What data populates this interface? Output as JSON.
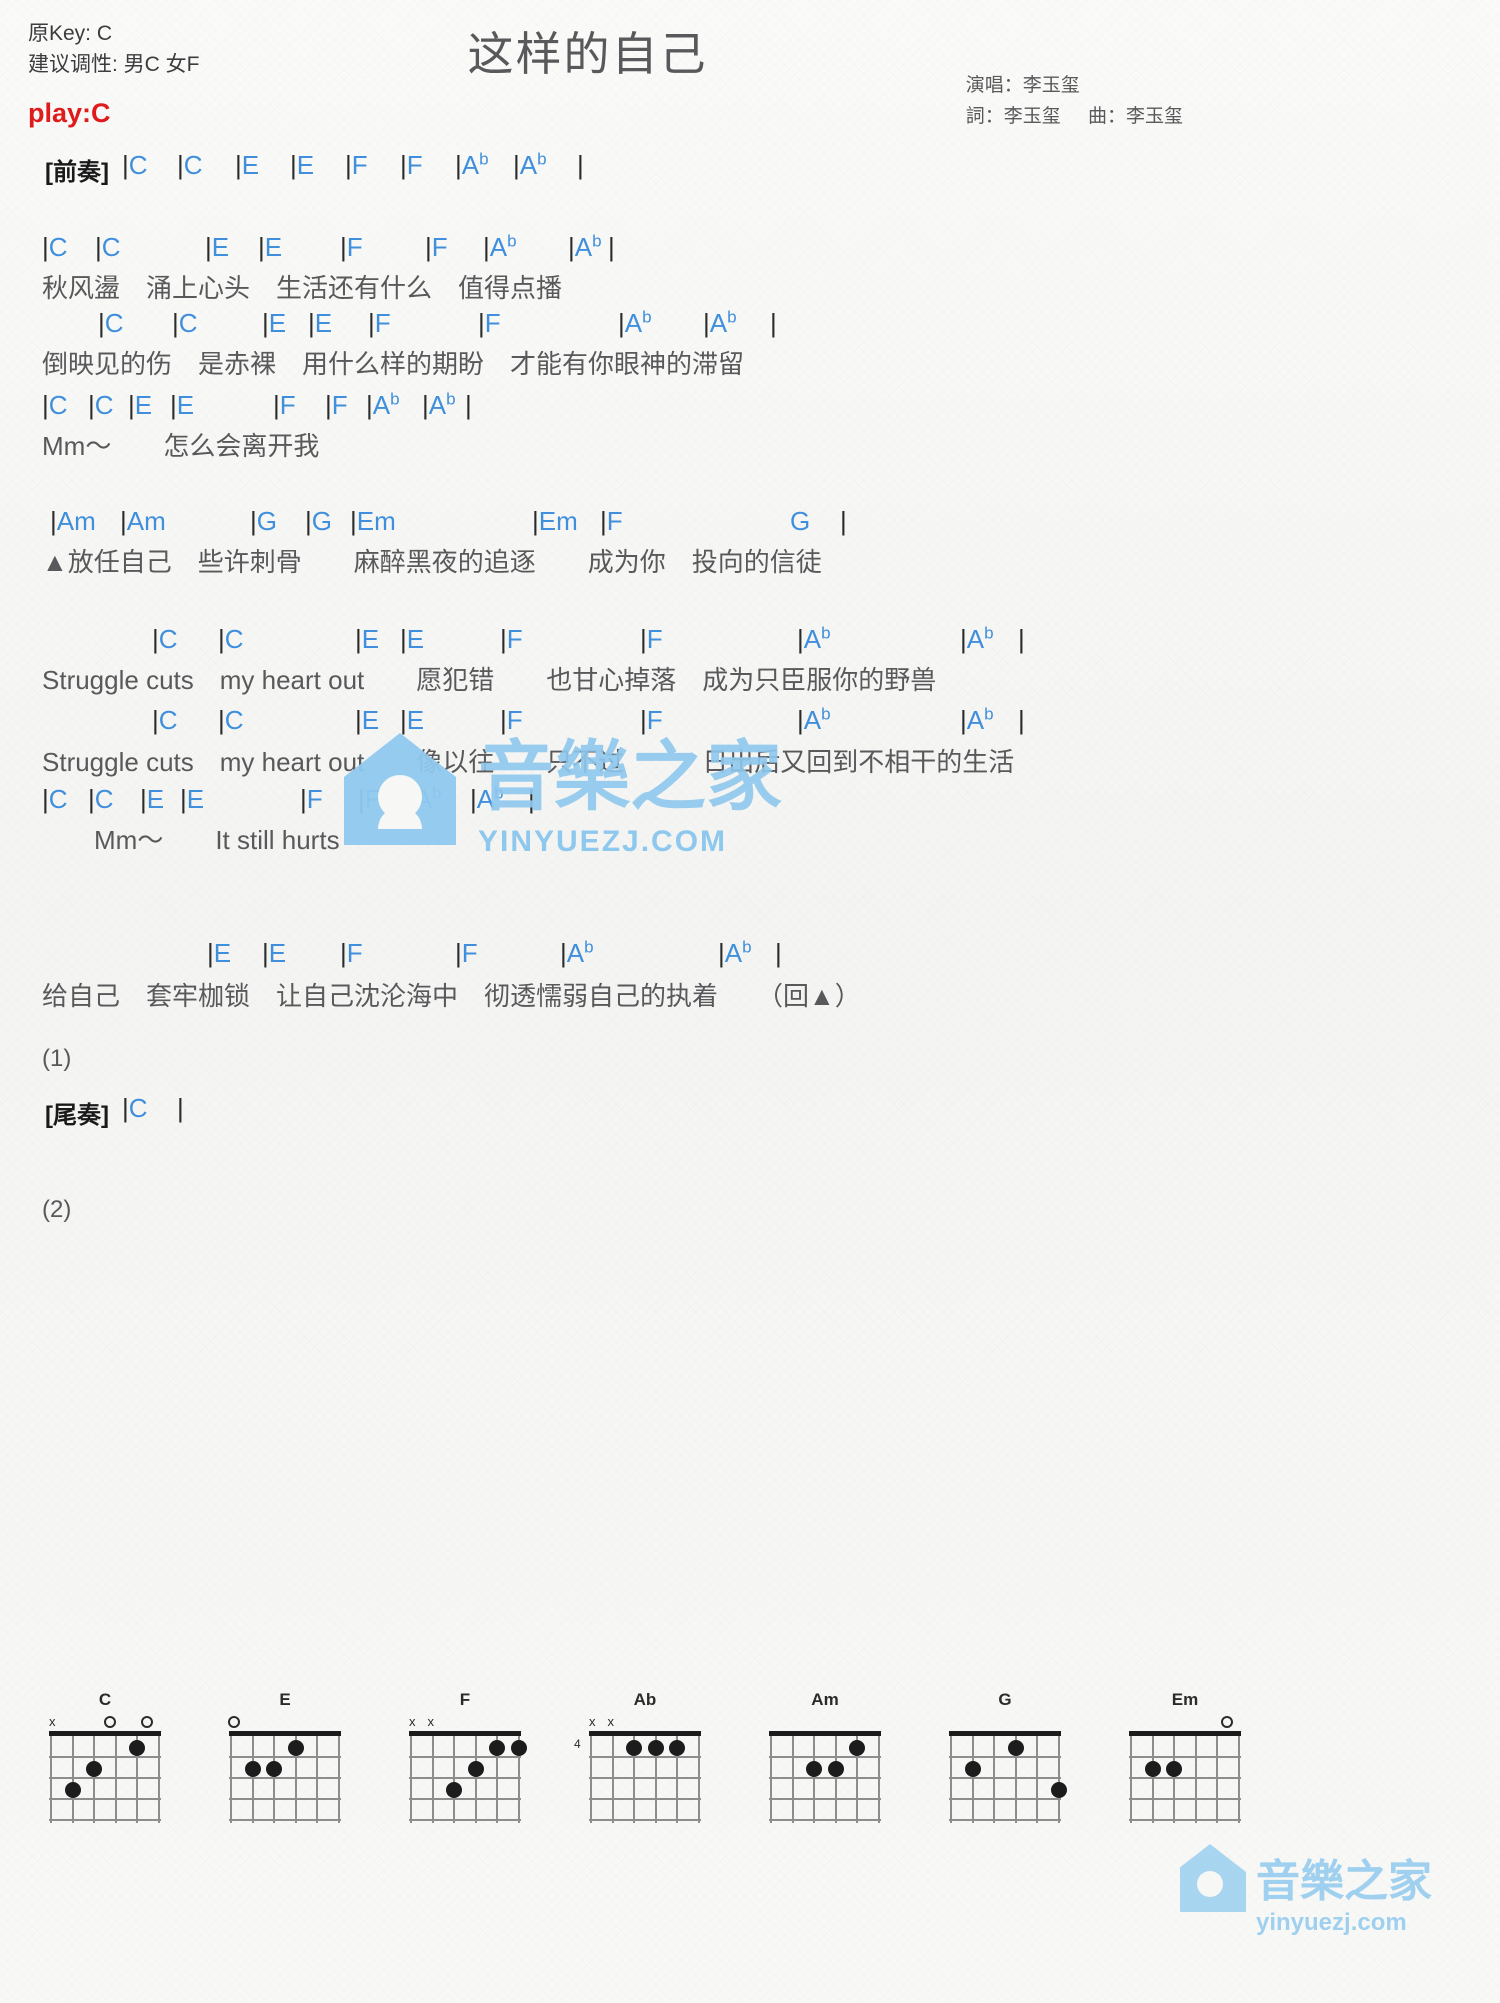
{
  "header": {
    "original_key_label": "原Key: C",
    "suggested_key_label": "建议调性: 男C 女F",
    "play_key": "play:C",
    "title": "这样的自己",
    "singer": "演唱：李玉玺",
    "lyricist": "詞：李玉玺",
    "composer": "曲：李玉玺",
    "play_key_color": "#e01b1b",
    "chord_color": "#3f8fdc",
    "text_color": "#59595b"
  },
  "sections": {
    "intro_label": "[前奏]",
    "outro_label": "[尾奏]",
    "verse1_marker": "▲",
    "repeat_note": "（回▲）",
    "alt1_label": "(1)",
    "alt2_label": "(2)"
  },
  "lines": [
    {
      "id": "intro",
      "label": "[前奏]",
      "chords": [
        "|C",
        "|C",
        "|E",
        "|E",
        "|F",
        "|F",
        "|Ab",
        "|Ab",
        "|"
      ],
      "lyric": ""
    },
    {
      "id": "verse1-l1",
      "chords": [
        "|C",
        "|C",
        "|E",
        "|E",
        "|F",
        "|F",
        "|Ab",
        "|Ab",
        "|"
      ],
      "lyric": "秋风盪　涌上心头　生活还有什么　值得点播"
    },
    {
      "id": "verse1-l2",
      "chords": [
        "|C",
        "|C",
        "|E",
        "|E",
        "|F",
        "|F",
        "|Ab",
        "|Ab",
        "|"
      ],
      "lyric": "倒映见的伤　是赤裸　用什么样的期盼　才能有你眼神的滞留"
    },
    {
      "id": "verse1-l3",
      "chords": [
        "|C",
        "|C",
        "|E",
        "|E",
        "|F",
        "|F",
        "|Ab",
        "|Ab",
        "|"
      ],
      "lyric": "Mm～　　怎么会离开我"
    },
    {
      "id": "chorus-l1",
      "chords": [
        "|Am",
        "|Am",
        "|G",
        "|G",
        "|Em",
        "|Em",
        "|F",
        "G",
        "|"
      ],
      "lyric": "▲放任自己　些许刺骨　　麻醉黑夜的追逐　　成为你　投向的信徒"
    },
    {
      "id": "chorus-l2",
      "chords": [
        "|C",
        "|C",
        "|E",
        "|E",
        "|F",
        "|F",
        "|Ab",
        "|Ab",
        "|"
      ],
      "lyric": "Struggle cuts　my heart out　　愿犯错　　也甘心掉落　成为只臣服你的野兽"
    },
    {
      "id": "chorus-l3",
      "chords": [
        "|C",
        "|C",
        "|E",
        "|E",
        "|F",
        "|F",
        "|Ab",
        "|Ab",
        "|"
      ],
      "lyric": "Struggle cuts　my heart out　　像以往　　只不过　　　日出后又回到不相干的生活"
    },
    {
      "id": "chorus-l4",
      "chords": [
        "|C",
        "|C",
        "|E",
        "|E",
        "|F",
        "|F",
        "|Ab",
        "|Ab",
        "|"
      ],
      "lyric": "　　Mm～　　It still hurts"
    },
    {
      "id": "alt1-line",
      "chords": [
        "|E",
        "|E",
        "|F",
        "|F",
        "|Ab",
        "|Ab",
        "|"
      ],
      "lyric": "给自己　套牢枷锁　让自己沈沦海中　彻透懦弱自己的执着　　（回▲）"
    },
    {
      "id": "outro",
      "label": "[尾奏]",
      "chords": [
        "|C",
        "|"
      ],
      "lyric": ""
    }
  ],
  "chord_diagrams": [
    {
      "name": "C",
      "top_marks": [
        {
          "type": "x",
          "string": 6
        },
        {
          "type": "o",
          "string": 3
        },
        {
          "type": "o",
          "string": 1
        }
      ],
      "dots": [
        {
          "string": 5,
          "fret": 3
        },
        {
          "string": 4,
          "fret": 2
        },
        {
          "string": 2,
          "fret": 1
        }
      ],
      "start_fret": ""
    },
    {
      "name": "E",
      "top_marks": [
        {
          "type": "o",
          "string": 6
        }
      ],
      "dots": [
        {
          "string": 5,
          "fret": 2
        },
        {
          "string": 4,
          "fret": 2
        },
        {
          "string": 3,
          "fret": 1
        }
      ],
      "start_fret": ""
    },
    {
      "name": "F",
      "top_marks": [
        {
          "type": "x",
          "string": 6
        },
        {
          "type": "x",
          "string": 5
        }
      ],
      "dots": [
        {
          "string": 4,
          "fret": 3
        },
        {
          "string": 3,
          "fret": 2
        },
        {
          "string": 2,
          "fret": 1
        },
        {
          "string": 1,
          "fret": 1
        }
      ],
      "start_fret": ""
    },
    {
      "name": "Ab",
      "top_marks": [
        {
          "type": "x",
          "string": 6
        },
        {
          "type": "x",
          "string": 5
        }
      ],
      "dots": [
        {
          "string": 4,
          "fret": 1
        },
        {
          "string": 3,
          "fret": 1
        },
        {
          "string": 2,
          "fret": 1
        }
      ],
      "start_fret": "4"
    },
    {
      "name": "Am",
      "top_marks": [],
      "dots": [
        {
          "string": 4,
          "fret": 2
        },
        {
          "string": 3,
          "fret": 2
        },
        {
          "string": 2,
          "fret": 1
        }
      ],
      "start_fret": ""
    },
    {
      "name": "G",
      "top_marks": [],
      "dots": [
        {
          "string": 5,
          "fret": 2
        },
        {
          "string": 3,
          "fret": 1
        },
        {
          "string": 1,
          "fret": 3
        }
      ],
      "start_fret": ""
    },
    {
      "name": "Em",
      "top_marks": [
        {
          "type": "o",
          "string": 1
        }
      ],
      "dots": [
        {
          "string": 5,
          "fret": 2
        },
        {
          "string": 4,
          "fret": 2
        }
      ],
      "start_fret": ""
    }
  ],
  "watermark": {
    "site": "yinyuezj.com",
    "brand": "音樂之家",
    "url_text": "YINYUEZJ.COM",
    "color": "#8fc8ee"
  }
}
